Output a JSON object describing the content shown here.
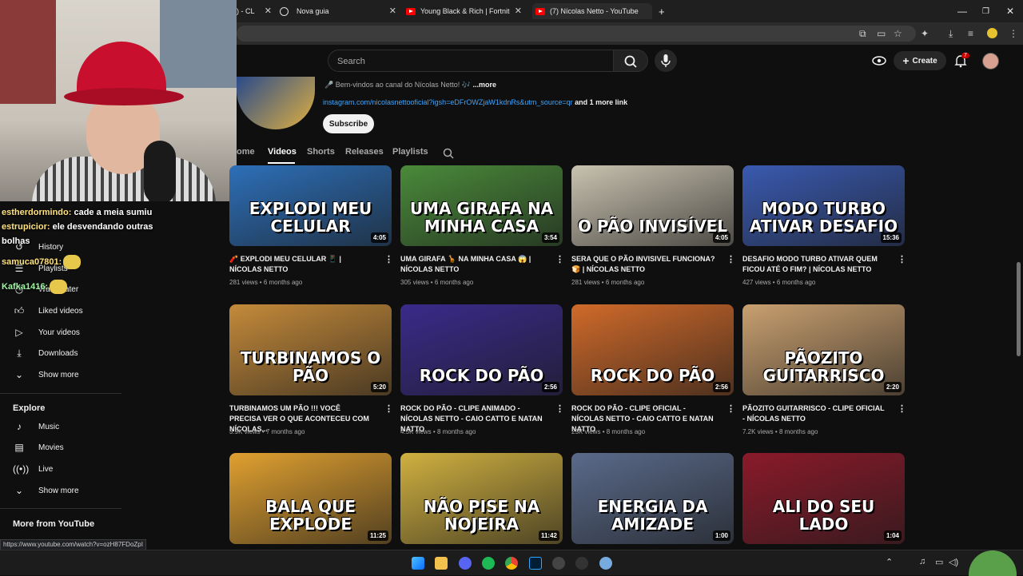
{
  "browser": {
    "tabs": [
      {
        "label": ") - CL",
        "icon": "youtube-icon"
      },
      {
        "label": "Nova guia",
        "icon": "globe-icon"
      },
      {
        "label": "Young Black & Rich | Fortnite E",
        "icon": "youtube-icon"
      },
      {
        "label": "(7) Nícolas Netto - YouTube",
        "icon": "youtube-icon"
      }
    ],
    "new_tab": "+",
    "status_url": "https://www.youtube.com/watch?v=ozH87FDoZpI"
  },
  "topbar": {
    "search_placeholder": "Search",
    "create_label": "Create",
    "notifications": "7"
  },
  "channel": {
    "welcome": "🎤 Bem-vindos ao canal do Nícolas Netto! 🎶",
    "more": "...more",
    "link": "instagram.com/nicolasnettooficial?igsh=eDFrOWZjaW1kdnRs&utm_source=qr",
    "more_links": "and 1 more link",
    "subscribe": "Subscribe",
    "tabs": [
      "ome",
      "Videos",
      "Shorts",
      "Releases",
      "Playlists"
    ],
    "active_tab": "Videos"
  },
  "sidebar": {
    "items_top": [
      {
        "label": "History",
        "icon": "history-icon"
      },
      {
        "label": "Playlists",
        "icon": "playlists-icon"
      },
      {
        "label": "Watch later",
        "icon": "clock-icon"
      },
      {
        "label": "Liked videos",
        "icon": "thumbs-up-icon"
      },
      {
        "label": "Your videos",
        "icon": "play-square-icon"
      },
      {
        "label": "Downloads",
        "icon": "download-icon"
      },
      {
        "label": "Show more",
        "icon": "chevron-down-icon"
      }
    ],
    "explore_title": "Explore",
    "explore_items": [
      {
        "label": "Music",
        "icon": "music-note-icon"
      },
      {
        "label": "Movies",
        "icon": "film-icon"
      },
      {
        "label": "Live",
        "icon": "live-icon"
      },
      {
        "label": "Show more",
        "icon": "chevron-down-icon"
      }
    ],
    "more_title": "More from YouTube"
  },
  "chat": [
    {
      "user": "estherdormindo:",
      "text": "cade a meia sumiu"
    },
    {
      "user": "estrupicior:",
      "text": "ele desvendando outras"
    },
    {
      "user": "",
      "text": "bolhas"
    },
    {
      "user": "samuca07801:",
      "text": ""
    },
    {
      "user": "Kafka1416:",
      "text": ""
    }
  ],
  "videos": [
    {
      "thumb_text": "EXPLODI MEU CELULAR",
      "duration": "4:05",
      "title": "🧨 EXPLODI MEU CELULAR 📱 | NÍCOLAS NETTO",
      "views": "281 views",
      "age": "6 months ago",
      "bg": "#2d6fb8"
    },
    {
      "thumb_text": "UMA GIRAFA NA MINHA CASA",
      "duration": "3:54",
      "title": "UMA GIRAFA 🦒 NA MINHA CASA 😱 | NÍCOLAS NETTO",
      "views": "305 views",
      "age": "6 months ago",
      "bg": "#4a8a3a"
    },
    {
      "thumb_text": "O PÃO INVISÍVEL",
      "duration": "4:05",
      "title": "SERA QUE O PÃO INVISIVEL FUNCIONA? 🍞 | NÍCOLAS NETTO",
      "views": "281 views",
      "age": "6 months ago",
      "bg": "#c9c2b0"
    },
    {
      "thumb_text": "MODO TURBO ATIVAR DESAFIO",
      "duration": "15:36",
      "title": "DESAFIO MODO TURBO ATIVAR QUEM FICOU ATÉ O FIM? | NÍCOLAS NETTO",
      "views": "427 views",
      "age": "6 months ago",
      "bg": "#3a5ab0"
    },
    {
      "thumb_text": "TURBINAMOS O PÃO",
      "duration": "5:20",
      "title": "TURBINAMOS UM PÃO !!! VOCÊ PRECISA VER O QUE ACONTECEU COM NÍCOLAS...",
      "views": "3.9K views",
      "age": "7 months ago",
      "bg": "#c48a3a"
    },
    {
      "thumb_text": "ROCK DO PÃO",
      "duration": "2:56",
      "title": "ROCK DO PÃO - CLIPE ANIMADO - NÍCOLAS NETTO - CAIO CATTO E NATAN NATTO",
      "views": "4.5K views",
      "age": "8 months ago",
      "bg": "#3a2a8a"
    },
    {
      "thumb_text": "ROCK DO PÃO",
      "duration": "2:56",
      "title": "ROCK DO PÃO - CLIPE OFICIAL - NÍCOLAS NETTO - CAIO CATTO E NATAN NATTO",
      "views": "25K views",
      "age": "8 months ago",
      "bg": "#d06a2a"
    },
    {
      "thumb_text": "PÃOZITO GUITARRISCO",
      "duration": "2:20",
      "title": "PÃOZITO GUITARRISCO - CLIPE OFICIAL - NÍCOLAS NETTO",
      "views": "7.2K views",
      "age": "8 months ago",
      "bg": "#c9a070"
    },
    {
      "thumb_text": "BALA QUE EXPLODE",
      "duration": "11:25",
      "title": "",
      "views": "",
      "age": "",
      "bg": "#e0a030"
    },
    {
      "thumb_text": "NÃO PISE NA NOJEIRA",
      "duration": "11:42",
      "title": "",
      "views": "",
      "age": "",
      "bg": "#d0b040"
    },
    {
      "thumb_text": "ENERGIA DA AMIZADE",
      "duration": "1:00",
      "title": "",
      "views": "",
      "age": "",
      "bg": "#5a6a8a"
    },
    {
      "thumb_text": "ALI DO SEU LADO",
      "duration": "1:04",
      "title": "",
      "views": "",
      "age": "",
      "bg": "#8a1a2a"
    }
  ]
}
